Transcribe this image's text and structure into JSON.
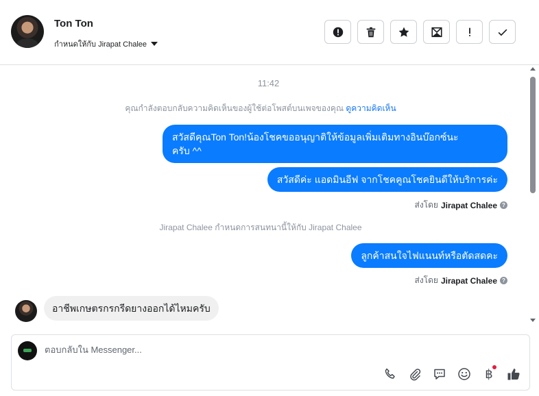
{
  "header": {
    "contact_name": "Ton Ton",
    "assign_label": "กำหนดให้กับ Jirapat Chalee"
  },
  "actions": [
    {
      "name": "mark-spam-button",
      "icon": "exclamation-circle-icon"
    },
    {
      "name": "delete-button",
      "icon": "trash-icon"
    },
    {
      "name": "star-button",
      "icon": "star-icon"
    },
    {
      "name": "archive-button",
      "icon": "archive-icon"
    },
    {
      "name": "follow-up-button",
      "icon": "exclamation-icon"
    },
    {
      "name": "mark-done-button",
      "icon": "check-icon"
    }
  ],
  "chat": {
    "time": "11:42",
    "system_note": "คุณกำลังตอบกลับความคิดเห็นของผู้ใช้ต่อโพสต์บนเพจของคุณ",
    "system_note_link": "ดูความคิดเห็น",
    "assign_note": "Jirapat Chalee กำหนดการสนทนานี้ให้กับ Jirapat Chalee",
    "sent_by_prefix": "ส่งโดย",
    "sent_by_name": "Jirapat Chalee",
    "msg1_line1": "สวัสดีคุณTon Ton!น้องโชคขออนุญาติให้ข้อมูลเพิ่มเติมทางอินบ๊อกซ์นะ",
    "msg1_line2": "ครับ ^^",
    "msg2": "สวัสดีค่ะ แอดมินอีฟ จากโชคคูณโชคยินดีให้บริการค่ะ",
    "msg3": "ลูกค้าสนใจไฟแนนท์หรือตัดสดคะ",
    "incoming": "อาชีพเกษตรกรกรีดยางออกได้ไหมครับ"
  },
  "composer": {
    "placeholder": "ตอบกลับใน Messenger...",
    "baht_symbol": "฿",
    "tools": [
      "phone-icon",
      "paperclip-icon",
      "saved-reply-icon",
      "emoji-icon",
      "baht-icon",
      "like-icon"
    ]
  },
  "colors": {
    "accent": "#0a7cff",
    "link": "#1877f2",
    "incoming_bg": "#f0f0f0",
    "muted": "#8d949e"
  }
}
